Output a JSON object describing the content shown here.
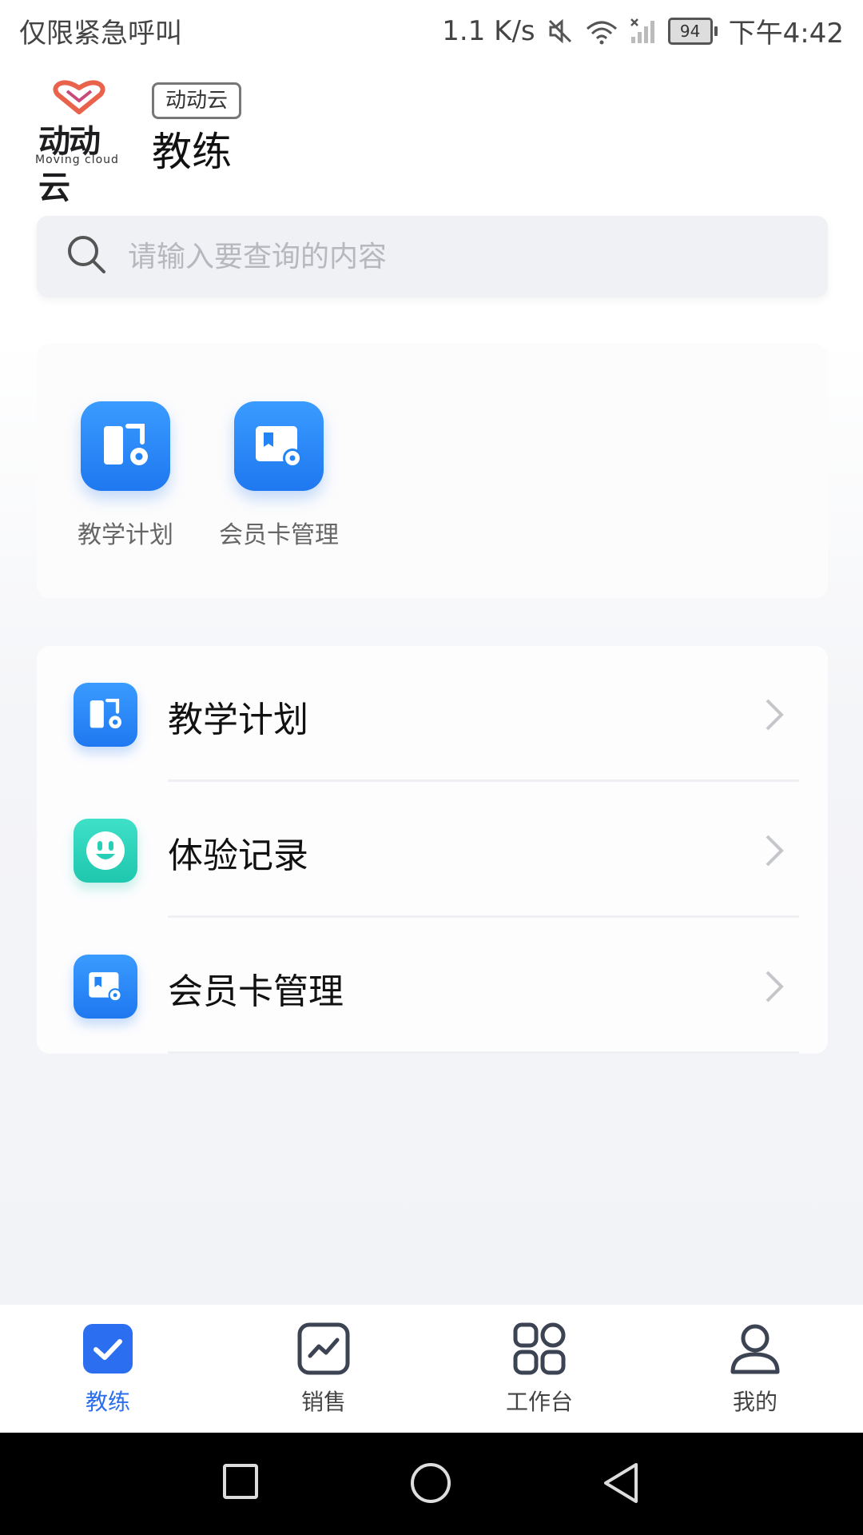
{
  "status_bar": {
    "carrier": "仅限紧急呼叫",
    "network_speed": "1.1 K/s",
    "battery": "94",
    "time": "下午4:42"
  },
  "header": {
    "logo_text": "动动云",
    "logo_subtext": "Moving cloud",
    "badge": "动动云",
    "title": "教练"
  },
  "search": {
    "placeholder": "请输入要查询的内容"
  },
  "quick_access": [
    {
      "label": "教学计划",
      "icon": "teaching-plan-icon"
    },
    {
      "label": "会员卡管理",
      "icon": "membership-card-icon"
    }
  ],
  "menu_list": [
    {
      "label": "教学计划",
      "icon": "teaching-plan-icon",
      "color": "#2284f5"
    },
    {
      "label": "体验记录",
      "icon": "smile-face-icon",
      "color": "#28cfb6"
    },
    {
      "label": "会员卡管理",
      "icon": "membership-card-icon",
      "color": "#2284f5"
    }
  ],
  "bottom_nav": [
    {
      "label": "教练",
      "icon": "check-square-icon",
      "active": true
    },
    {
      "label": "销售",
      "icon": "chart-line-icon",
      "active": false
    },
    {
      "label": "工作台",
      "icon": "grid-apps-icon",
      "active": false
    },
    {
      "label": "我的",
      "icon": "user-icon",
      "active": false
    }
  ],
  "colors": {
    "accent": "#2b6ef0",
    "primary_icon": "#2284f5",
    "teal_icon": "#28cfb6"
  }
}
